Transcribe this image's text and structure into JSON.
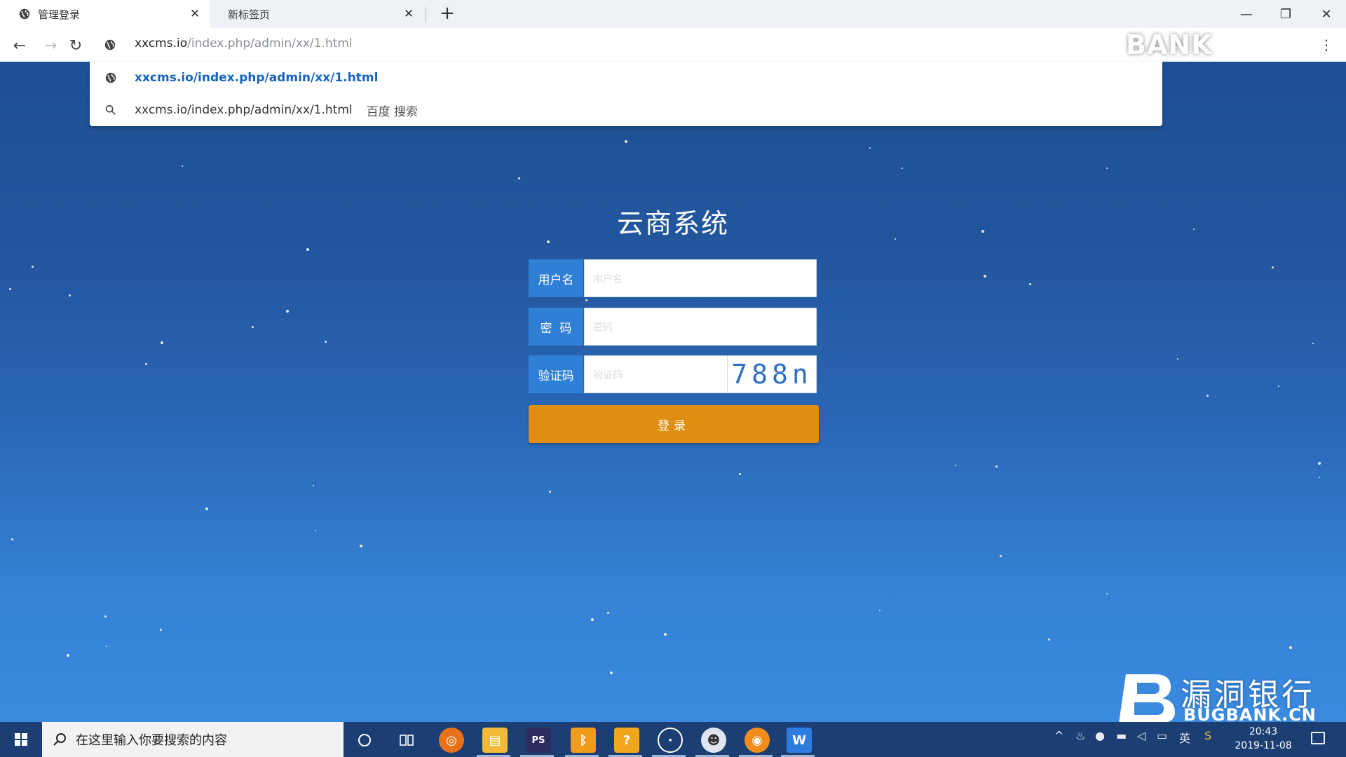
{
  "browser": {
    "tabs": [
      {
        "label": "管理登录",
        "active": true
      },
      {
        "label": "新标签页",
        "active": false
      }
    ],
    "new_tab_label": "+",
    "address": {
      "host": "xxcms.io",
      "path": "/index.php/admin/xx/1.html"
    },
    "suggestions": [
      {
        "text": "xxcms.io/index.php/admin/xx/1.html",
        "kind": "url"
      },
      {
        "text": "xxcms.io/index.php/admin/xx/1.html",
        "extra": "百度 搜索",
        "kind": "search"
      }
    ],
    "overlay_text": "BANK"
  },
  "login": {
    "title": "云商系统",
    "username_label": "用户名",
    "password_label": "密  码",
    "captcha_label": "验证码",
    "username_placeholder": "用户名",
    "password_placeholder": "密码",
    "captcha_placeholder": "验证码",
    "captcha_value": "788n",
    "submit_label": "登录"
  },
  "watermark": {
    "cn": "漏洞银行",
    "en": "BUGBANK.CN"
  },
  "taskbar": {
    "search_placeholder": "在这里输入你要搜索的内容",
    "time": "20:43",
    "date": "2019-11-08",
    "apps": [
      "netease-music-icon",
      "file-explorer-icon",
      "phpstorm-icon",
      "bandizip-icon",
      "folder-icon",
      "clock-app-icon",
      "panda-icon",
      "browser-icon",
      "wps-icon"
    ]
  },
  "colors": {
    "accent_blue": "#2f7fd6",
    "button_orange": "#e08e12",
    "link_blue": "#1565c0"
  }
}
